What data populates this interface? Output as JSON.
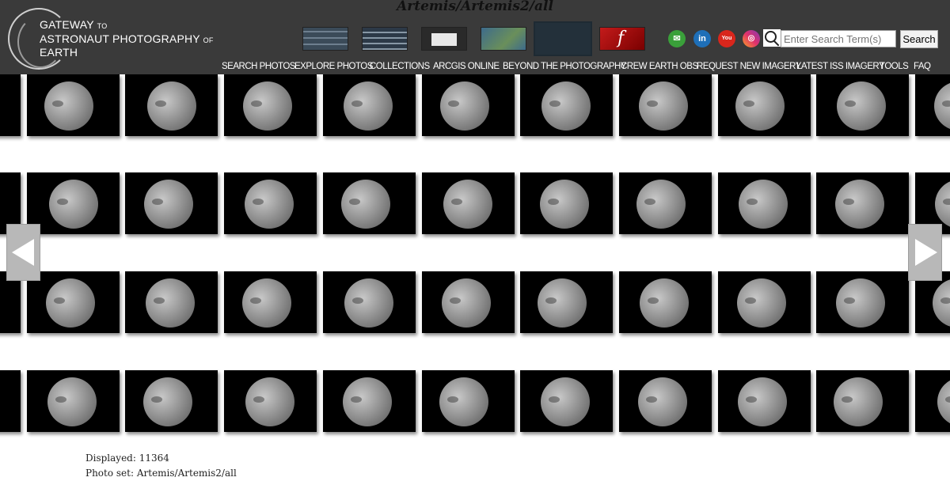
{
  "header": {
    "photo_set_title": "Artemis/Artemis2/all",
    "logo": {
      "line1_big": "Gateway",
      "line1_small": "to",
      "line2_big": "Astronaut Photography",
      "line2_small": "of",
      "line3_big": "Earth"
    },
    "view_icons": [
      "list-view-icon",
      "table-view-icon",
      "detail-view-icon",
      "map-view-icon",
      "grid-view-icon",
      "flash-view-icon"
    ],
    "selected_view": "grid-view-icon",
    "social_icons": [
      "email-icon",
      "linkedin-icon",
      "youtube-icon",
      "instagram-icon"
    ],
    "search": {
      "placeholder": "Enter Search Term(s)",
      "value": "",
      "button_label": "Search"
    },
    "nav": [
      "Search Photos",
      "Explore Photos",
      "Collections",
      "ArcGIS Online",
      "Beyond the Photography",
      "Crew Earth Obs",
      "Request New Imagery",
      "Latest ISS Imagery",
      "Tools",
      "FAQ"
    ]
  },
  "colors": {
    "header_bg": "#3a3a3a",
    "thumb_bg": "#000000",
    "arrow_bg": "#b8b8b8"
  },
  "grid": {
    "rows": 4,
    "columns_visible": 11,
    "thumbnail_subject": "moon"
  },
  "pager": {
    "prev_icon": "left-arrow-icon",
    "next_icon": "right-arrow-icon"
  },
  "footer": {
    "displayed_label": "Displayed:",
    "displayed_count": "11364",
    "photo_set_label": "Photo set:",
    "photo_set_value": "Artemis/Artemis2/all"
  }
}
